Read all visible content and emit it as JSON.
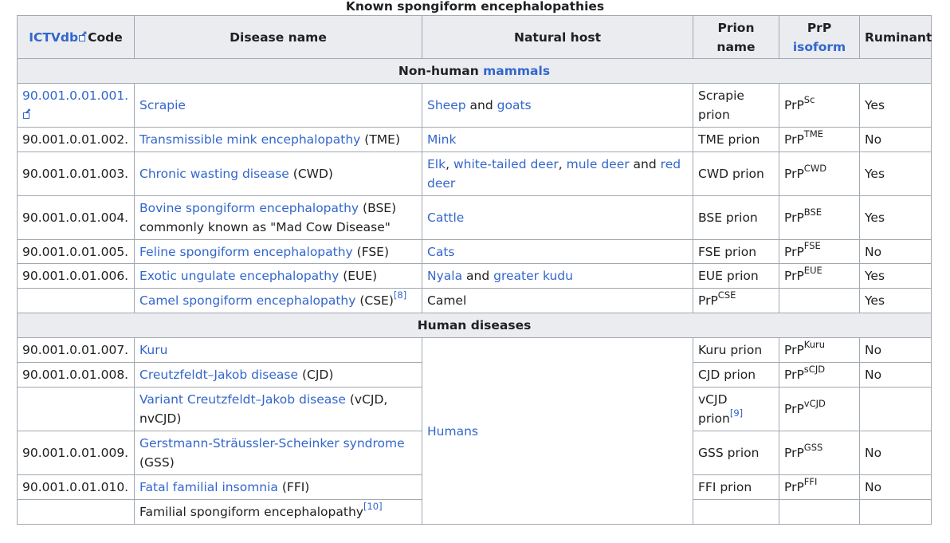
{
  "caption": "Known spongiform encephalopathies",
  "headers": {
    "code_link": "ICTVdb",
    "code_suffix": "Code",
    "disease": "Disease name",
    "host": "Natural host",
    "prion": "Prion name",
    "prp_line1": "PrP",
    "prp_line2": "isoform",
    "ruminant": "Ruminant"
  },
  "sections": {
    "nonhuman_prefix": "Non-human",
    "nonhuman_link": "mammals",
    "human": "Human diseases"
  },
  "rows": [
    {
      "code": "90.001.0.01.001.",
      "disease": "Scrapie",
      "host_a": "Sheep",
      "host_and": "and",
      "host_b": "goats",
      "prion": "Scrapie prion",
      "prp_sup": "Sc",
      "ruminant": "Yes"
    },
    {
      "code": "90.001.0.01.002.",
      "disease": "Transmissible mink encephalopathy",
      "disease_abbr": "(TME)",
      "host": "Mink",
      "prion": "TME prion",
      "prp_sup": "TME",
      "ruminant": "No"
    },
    {
      "code": "90.001.0.01.003.",
      "disease": "Chronic wasting disease",
      "disease_abbr": "(CWD)",
      "host_a": "Elk",
      "host_b": "white-tailed deer",
      "host_c": "mule deer",
      "host_and": "and",
      "host_d": "red deer",
      "prion": "CWD prion",
      "prp_sup": "CWD",
      "ruminant": "Yes"
    },
    {
      "code": "90.001.0.01.004.",
      "disease": "Bovine spongiform encephalopathy",
      "disease_abbr": "(BSE)",
      "disease_note": "commonly known as \"Mad Cow Disease\"",
      "host": "Cattle",
      "prion": "BSE prion",
      "prp_sup": "BSE",
      "ruminant": "Yes"
    },
    {
      "code": "90.001.0.01.005.",
      "disease": "Feline spongiform encephalopathy",
      "disease_abbr": "(FSE)",
      "host": "Cats",
      "prion": "FSE prion",
      "prp_sup": "FSE",
      "ruminant": "No"
    },
    {
      "code": "90.001.0.01.006.",
      "disease": "Exotic ungulate encephalopathy",
      "disease_abbr": "(EUE)",
      "host_a": "Nyala",
      "host_and": "and",
      "host_b": "greater kudu",
      "prion": "EUE prion",
      "prp_sup": "EUE",
      "ruminant": "Yes"
    },
    {
      "code": "",
      "disease": "Camel spongiform encephalopathy",
      "disease_abbr": "(CSE)",
      "ref": "[8]",
      "host": "Camel",
      "prion_prp_sup": "CSE",
      "ruminant": "Yes"
    },
    {
      "code": "90.001.0.01.007.",
      "disease": "Kuru",
      "prion": "Kuru prion",
      "prp_sup": "Kuru",
      "ruminant": "No"
    },
    {
      "code": "90.001.0.01.008.",
      "disease": "Creutzfeldt–Jakob disease",
      "disease_abbr": "(CJD)",
      "prion": "CJD prion",
      "prp_sup": "sCJD",
      "ruminant": "No"
    },
    {
      "code": "",
      "disease": "Variant Creutzfeldt–Jakob disease",
      "disease_abbr": "(vCJD, nvCJD)",
      "prion": "vCJD prion",
      "ref": "[9]",
      "prp_sup": "vCJD",
      "ruminant": ""
    },
    {
      "code": "90.001.0.01.009.",
      "disease": "Gerstmann-Sträussler-Scheinker syndrome",
      "disease_abbr": "(GSS)",
      "prion": "GSS prion",
      "prp_sup": "GSS",
      "ruminant": "No"
    },
    {
      "code": "90.001.0.01.010.",
      "disease": "Fatal familial insomnia",
      "disease_abbr": "(FFI)",
      "prion": "FFI prion",
      "prp_sup": "FFI",
      "ruminant": "No"
    },
    {
      "code": "",
      "disease": "Familial spongiform encephalopathy",
      "ref": "[10]",
      "prion": "",
      "ruminant": ""
    }
  ],
  "human_host": "Humans",
  "prp_prefix": "PrP",
  "separator": ",",
  "colors": {
    "link": "#3366cc",
    "header_bg": "#eaecf0",
    "border": "#a2a9b1",
    "text": "#202122"
  }
}
